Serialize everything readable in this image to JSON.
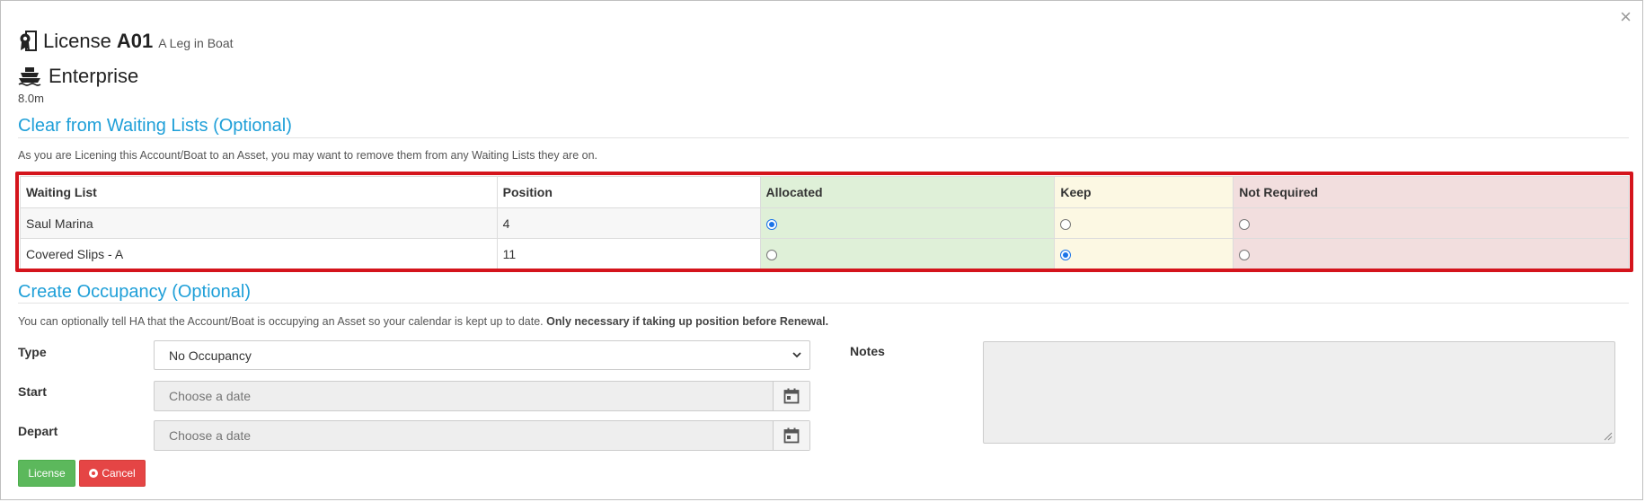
{
  "dialog": {
    "close_glyph": "×"
  },
  "header": {
    "license_word": "License",
    "license_code": "A01",
    "license_sub": "A Leg in Boat",
    "license_icon": "license-badge-icon",
    "boat_name": "Enterprise",
    "boat_icon": "boat-icon",
    "boat_size": "8.0m"
  },
  "waiting_lists": {
    "title": "Clear from Waiting Lists (Optional)",
    "description": "As you are Licening this Account/Boat to an Asset, you may want to remove them from any Waiting Lists they are on.",
    "columns": [
      "Waiting List",
      "Position",
      "Allocated",
      "Keep",
      "Not Required"
    ],
    "rows": [
      {
        "name": "Saul Marina",
        "position": "4",
        "selected": "Allocated"
      },
      {
        "name": "Covered Slips - A",
        "position": "11",
        "selected": "Keep"
      }
    ],
    "colors": {
      "allocated": "#dff0d8",
      "keep": "#fcf8e3",
      "not_required": "#f2dede",
      "highlight_border": "#d4141c"
    }
  },
  "occupancy": {
    "title": "Create Occupancy (Optional)",
    "description": "You can optionally tell HA that the Account/Boat is occupying an Asset so your calendar is kept up to date.",
    "description_bold": "Only necessary if taking up position before Renewal.",
    "type_label": "Type",
    "type_value": "No Occupancy",
    "start_label": "Start",
    "start_placeholder": "Choose a date",
    "depart_label": "Depart",
    "depart_placeholder": "Choose a date",
    "notes_label": "Notes"
  },
  "actions": {
    "license_label": "License",
    "cancel_label": "Cancel",
    "license_color": "#5cb85c",
    "cancel_color": "#e54545"
  }
}
